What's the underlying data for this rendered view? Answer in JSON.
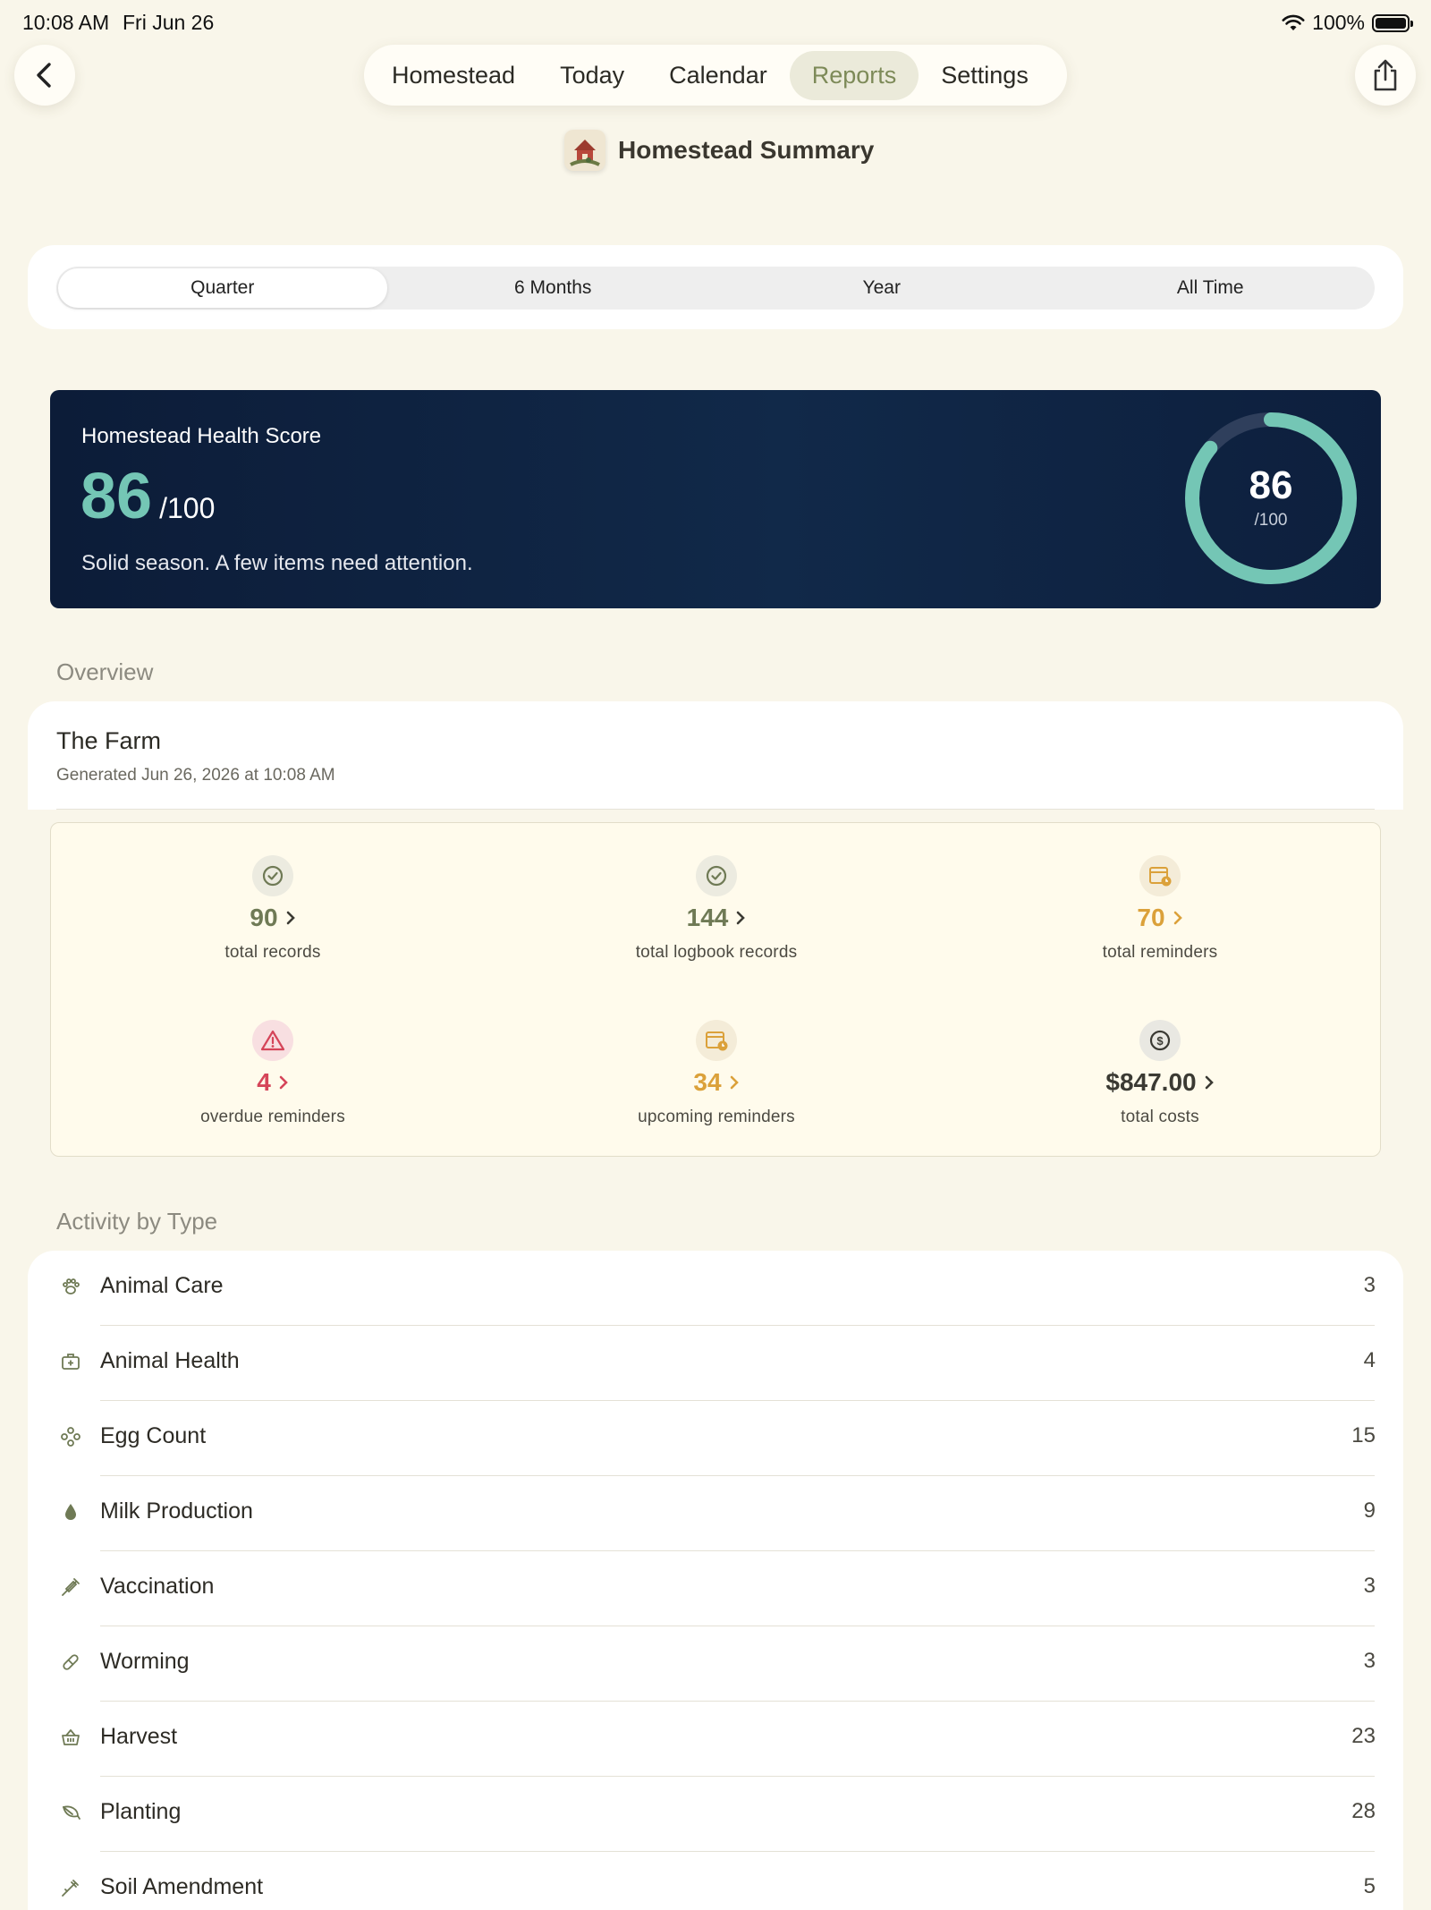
{
  "status": {
    "time": "10:08 AM",
    "date": "Fri Jun 26",
    "battery": "100%"
  },
  "nav": {
    "tabs": [
      {
        "label": "Homestead"
      },
      {
        "label": "Today"
      },
      {
        "label": "Calendar"
      },
      {
        "label": "Reports",
        "active": true
      },
      {
        "label": "Settings"
      }
    ]
  },
  "header": {
    "title": "Homestead Summary"
  },
  "range": {
    "options": [
      "Quarter",
      "6 Months",
      "Year",
      "All Time"
    ],
    "selected": "Quarter"
  },
  "health": {
    "label": "Homestead Health Score",
    "score": "86",
    "out_of": "/100",
    "message": "Solid season. A few items need attention.",
    "progress": 0.86
  },
  "overview": {
    "section_label": "Overview",
    "farm_name": "The Farm",
    "generated": "Generated Jun 26, 2026 at 10:08 AM"
  },
  "stats": [
    {
      "value": "90",
      "label": "total records",
      "icon": "check-circle-icon",
      "color": "green"
    },
    {
      "value": "144",
      "label": "total logbook records",
      "icon": "check-circle-icon",
      "color": "green"
    },
    {
      "value": "70",
      "label": "total reminders",
      "icon": "calendar-clock-icon",
      "color": "orange"
    },
    {
      "value": "4",
      "label": "overdue reminders",
      "icon": "warning-icon",
      "color": "red"
    },
    {
      "value": "34",
      "label": "upcoming reminders",
      "icon": "calendar-clock-icon",
      "color": "orange"
    },
    {
      "value": "$847.00",
      "label": "total costs",
      "icon": "dollar-circle-icon",
      "color": "dark"
    }
  ],
  "activity": {
    "section_label": "Activity by Type",
    "items": [
      {
        "name": "Animal Care",
        "count": "3",
        "icon": "paw-icon"
      },
      {
        "name": "Animal Health",
        "count": "4",
        "icon": "medical-kit-icon"
      },
      {
        "name": "Egg Count",
        "count": "15",
        "icon": "eggs-icon"
      },
      {
        "name": "Milk Production",
        "count": "9",
        "icon": "drop-icon"
      },
      {
        "name": "Vaccination",
        "count": "3",
        "icon": "syringe-icon"
      },
      {
        "name": "Worming",
        "count": "3",
        "icon": "pill-icon"
      },
      {
        "name": "Harvest",
        "count": "23",
        "icon": "basket-icon"
      },
      {
        "name": "Planting",
        "count": "28",
        "icon": "leaf-icon"
      },
      {
        "name": "Soil Amendment",
        "count": "5",
        "icon": "eyedropper-icon"
      }
    ]
  }
}
